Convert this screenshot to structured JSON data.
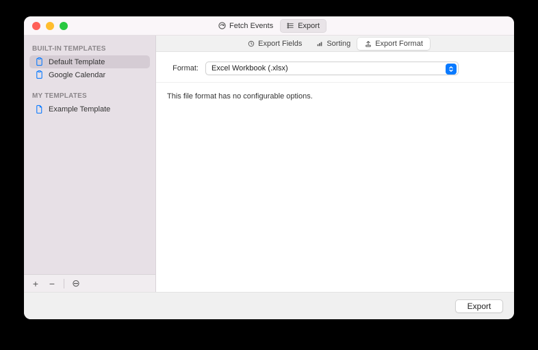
{
  "titlebar": {
    "segments": [
      {
        "label": "Fetch Events",
        "icon": "fetch-icon",
        "active": false
      },
      {
        "label": "Export",
        "icon": "list-icon",
        "active": true
      }
    ]
  },
  "sidebar": {
    "sections": [
      {
        "header": "BUILT-IN TEMPLATES",
        "items": [
          {
            "label": "Default Template",
            "icon": "template-icon",
            "selected": true
          },
          {
            "label": "Google Calendar",
            "icon": "template-icon",
            "selected": false
          }
        ]
      },
      {
        "header": "MY TEMPLATES",
        "items": [
          {
            "label": "Example Template",
            "icon": "document-icon",
            "selected": false
          }
        ]
      }
    ],
    "footer": {
      "add": "+",
      "remove": "−",
      "action": "⊖"
    }
  },
  "tabs": [
    {
      "label": "Export Fields",
      "icon": "clock-icon",
      "selected": false
    },
    {
      "label": "Sorting",
      "icon": "bars-icon",
      "selected": false
    },
    {
      "label": "Export Format",
      "icon": "output-icon",
      "selected": true
    }
  ],
  "form": {
    "format_label": "Format:",
    "format_value": "Excel Workbook (.xlsx)"
  },
  "note": "This file format has no configurable options.",
  "footer": {
    "export_label": "Export"
  }
}
